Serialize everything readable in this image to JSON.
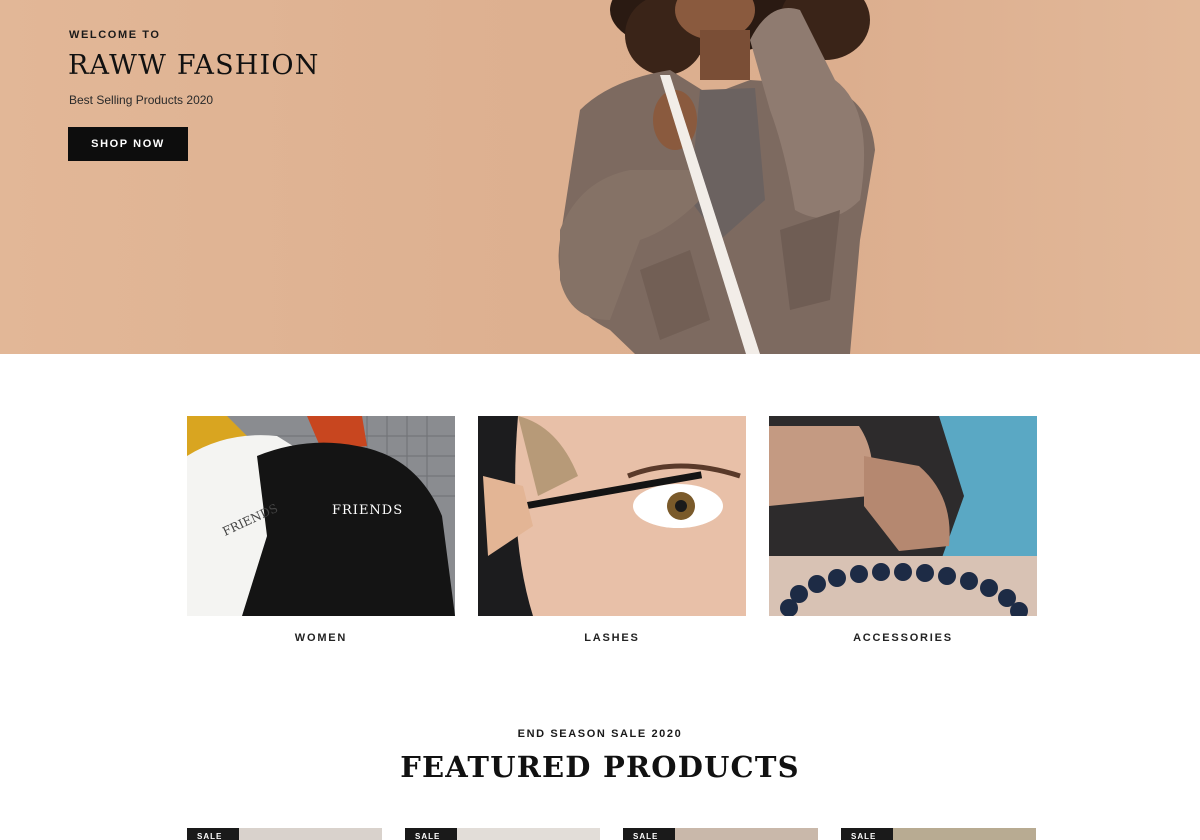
{
  "hero": {
    "eyebrow": "WELCOME TO",
    "title": "RAWW FASHION",
    "subtitle": "Best Selling Products 2020",
    "cta_label": "SHOP NOW",
    "background_color": "#ddb090",
    "cta_color": "#0d0d0d"
  },
  "categories": [
    {
      "label": "WOMEN",
      "image_text": "FRIENDS"
    },
    {
      "label": "LASHES"
    },
    {
      "label": "ACCESSORIES"
    }
  ],
  "featured": {
    "eyebrow": "END SEASON SALE 2020",
    "title": "FEATURED PRODUCTS",
    "products": [
      {
        "badge": "SALE"
      },
      {
        "badge": "SALE"
      },
      {
        "badge": "SALE"
      },
      {
        "badge": "SALE"
      }
    ]
  }
}
